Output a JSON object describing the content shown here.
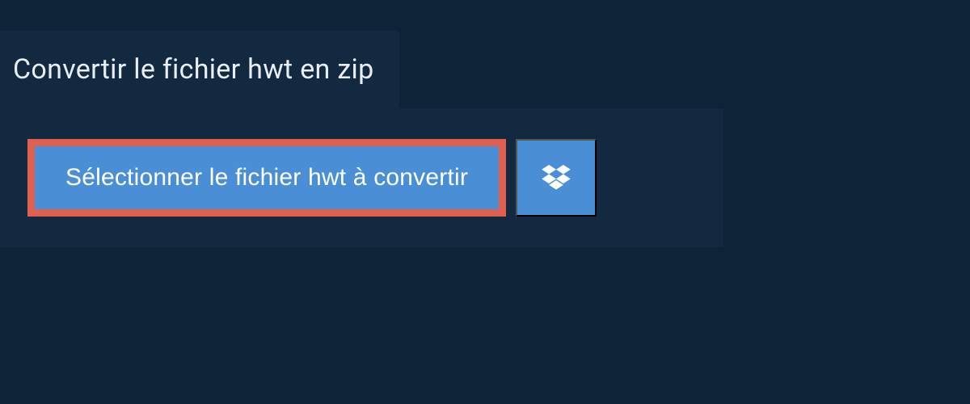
{
  "header": {
    "title": "Convertir le fichier hwt en zip"
  },
  "upload": {
    "select_button_label": "Sélectionner le fichier hwt à convertir"
  },
  "colors": {
    "background": "#0f2338",
    "panel": "#12293f",
    "button_primary": "#4a8fd6",
    "button_highlight_border": "#e0604f",
    "text_light": "#e8eef4"
  }
}
